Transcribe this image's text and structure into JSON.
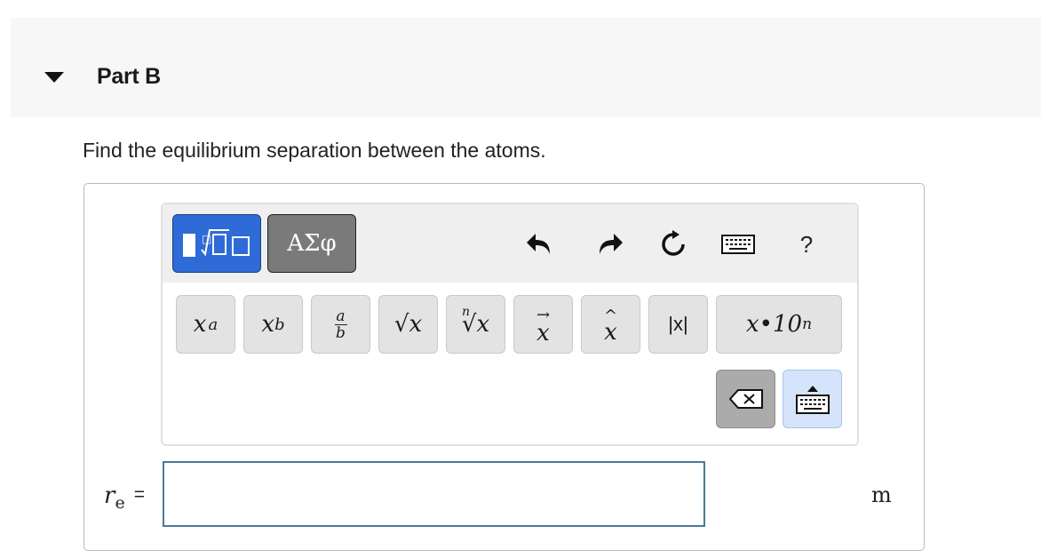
{
  "header": {
    "part_label": "Part B"
  },
  "question": {
    "text": "Find the equilibrium separation between the atoms."
  },
  "toolbar": {
    "greek_label": "ΑΣφ",
    "help_label": "?",
    "icons": [
      "templates-icon",
      "undo-icon",
      "redo-icon",
      "reset-icon",
      "keyboard-icon",
      "help-icon"
    ]
  },
  "keypad": {
    "keys": [
      {
        "name": "superscript",
        "base": "x",
        "sup": "a"
      },
      {
        "name": "subscript",
        "base": "x",
        "sub": "b"
      },
      {
        "name": "fraction",
        "num": "a",
        "den": "b"
      },
      {
        "name": "square-root",
        "label": "√x"
      },
      {
        "name": "nth-root",
        "index": "n",
        "label": "√x"
      },
      {
        "name": "vector",
        "label": "x",
        "accent": "→"
      },
      {
        "name": "unit-vector",
        "label": "x",
        "accent": "^"
      },
      {
        "name": "absolute-value",
        "label": "|x|"
      },
      {
        "name": "scientific-notation",
        "label": "x•10",
        "sup": "n"
      }
    ]
  },
  "answer": {
    "label_var": "r",
    "label_sub": "e",
    "label_eq": "=",
    "value": "",
    "unit": "m"
  },
  "colors": {
    "accent": "#2e6bd6",
    "input_border": "#4a7a98"
  }
}
